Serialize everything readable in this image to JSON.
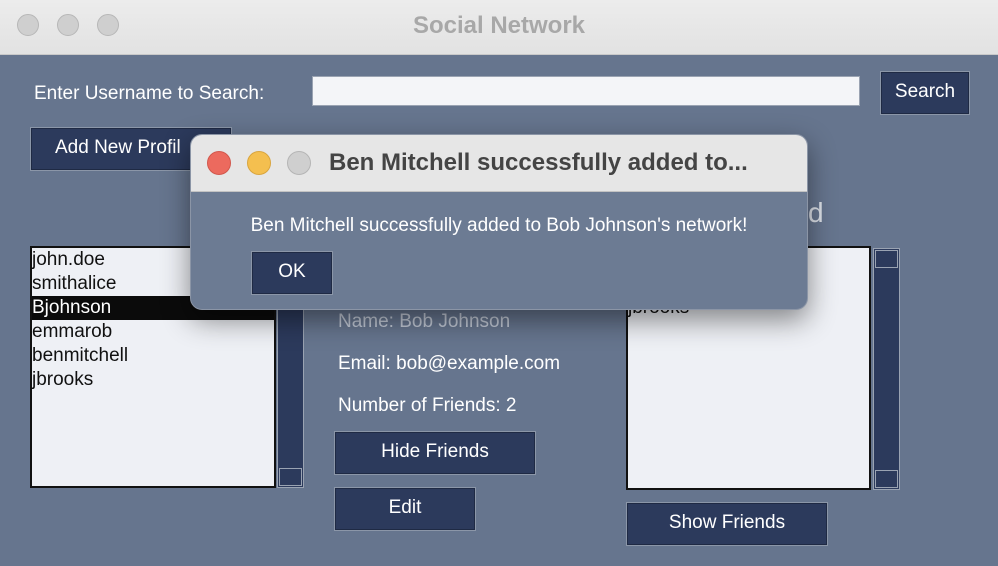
{
  "window": {
    "title": "Social Network"
  },
  "search": {
    "label": "Enter Username to Search:",
    "value": "",
    "button": "Search"
  },
  "add_profile_button": "Add New Profil",
  "users_list": [
    "john.doe",
    "smithalice",
    "Bjohnson",
    "emmarob",
    "benmitchell",
    "jbrooks"
  ],
  "selected_user_index": 2,
  "details": {
    "name": "Name: Bob Johnson",
    "email": "Email: bob@example.com",
    "friends_count": "Number of Friends: 2",
    "hide_friends_button": "Hide Friends",
    "edit_button": "Edit"
  },
  "friends_panel": {
    "heading_partial": "d",
    "items": [
      "",
      "",
      "jbrooks"
    ],
    "show_friends_button": "Show Friends"
  },
  "dialog": {
    "title": "Ben Mitchell successfully added to...",
    "message": "Ben Mitchell successfully added to Bob Johnson's network!",
    "ok_button": "OK",
    "colors": {
      "close": "#ec6a5e",
      "minimize": "#f4bf4f",
      "zoom": "#cfcfcf"
    }
  }
}
